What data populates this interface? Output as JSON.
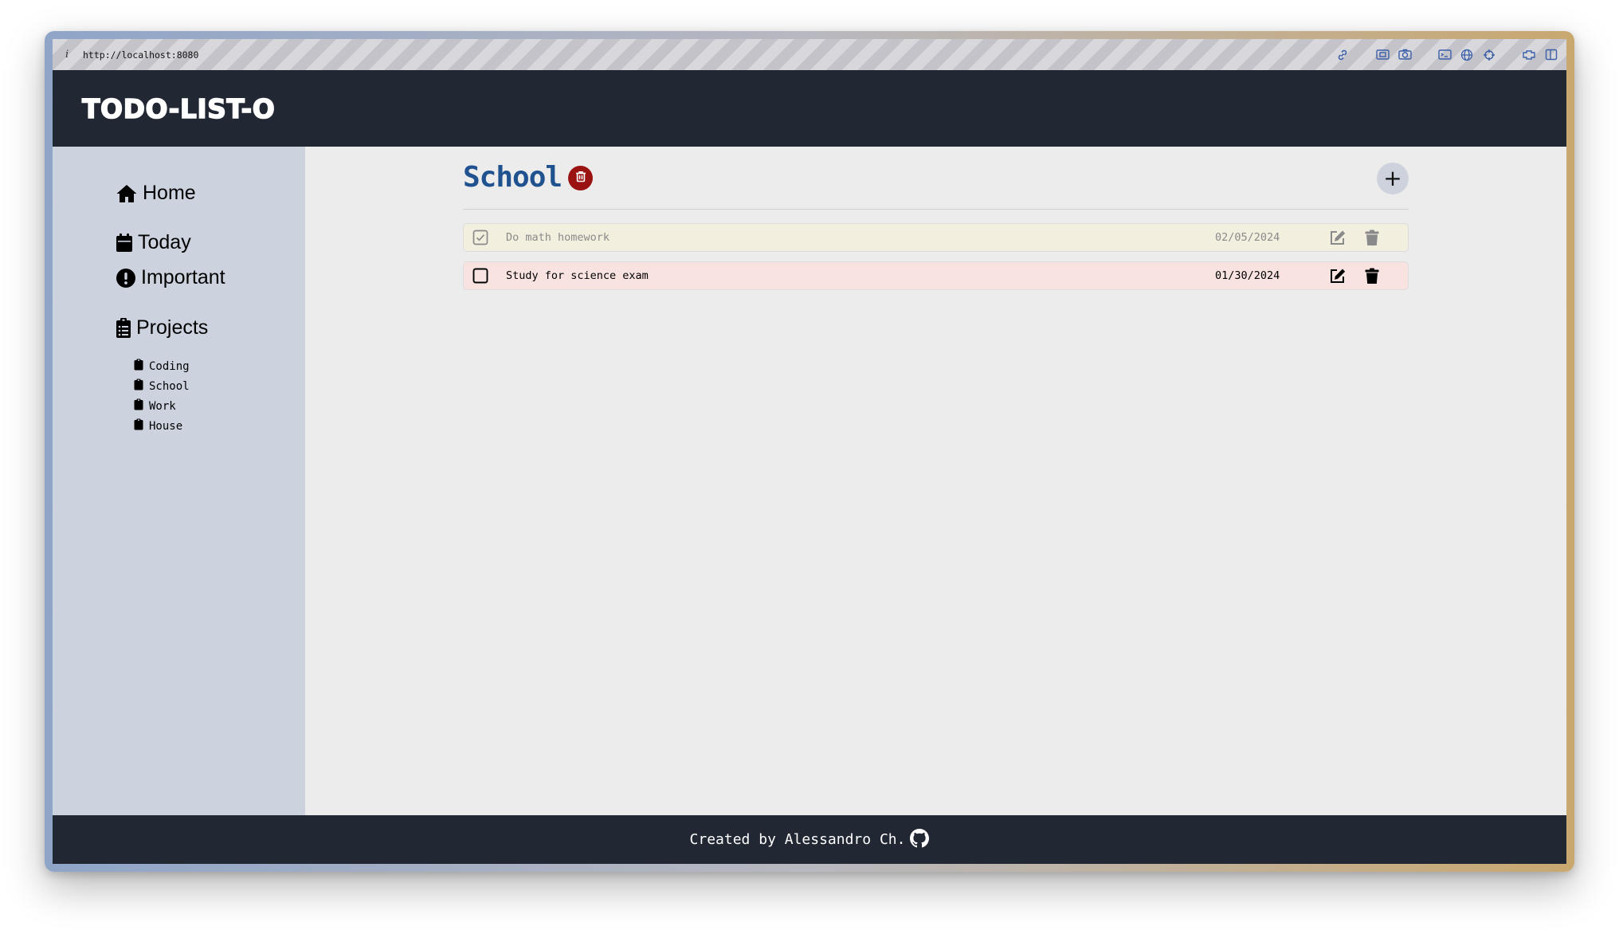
{
  "browser": {
    "info_glyph": "i",
    "url": "http://localhost:8080",
    "toolbar_icons": [
      "link-icon",
      "screenshot-area-icon",
      "camera-icon",
      "terminal-icon",
      "globe-icon",
      "crosshair-icon",
      "extension-icon",
      "sidebar-toggle-icon"
    ]
  },
  "header": {
    "brand": "TODO-LIST-O"
  },
  "sidebar": {
    "home": "Home",
    "today": "Today",
    "important": "Important",
    "projects": "Projects",
    "project_items": [
      "Coding",
      "School",
      "Work",
      "House"
    ]
  },
  "main": {
    "project_title": "School",
    "add_label": "+",
    "tasks": [
      {
        "title": "Do math homework",
        "date": "02/05/2024",
        "completed": true,
        "priority": "low"
      },
      {
        "title": "Study for science exam",
        "date": "01/30/2024",
        "completed": false,
        "priority": "high"
      }
    ]
  },
  "footer": {
    "text": "Created by Alessandro Ch."
  },
  "colors": {
    "header_bg": "#222833",
    "sidebar_bg": "#ccd3de",
    "main_bg": "#ececec",
    "title_color": "#20528f",
    "delete_project_bg": "#9b1212",
    "task_done_bg": "#f2efdf",
    "task_high_bg": "#f8e3e1"
  }
}
